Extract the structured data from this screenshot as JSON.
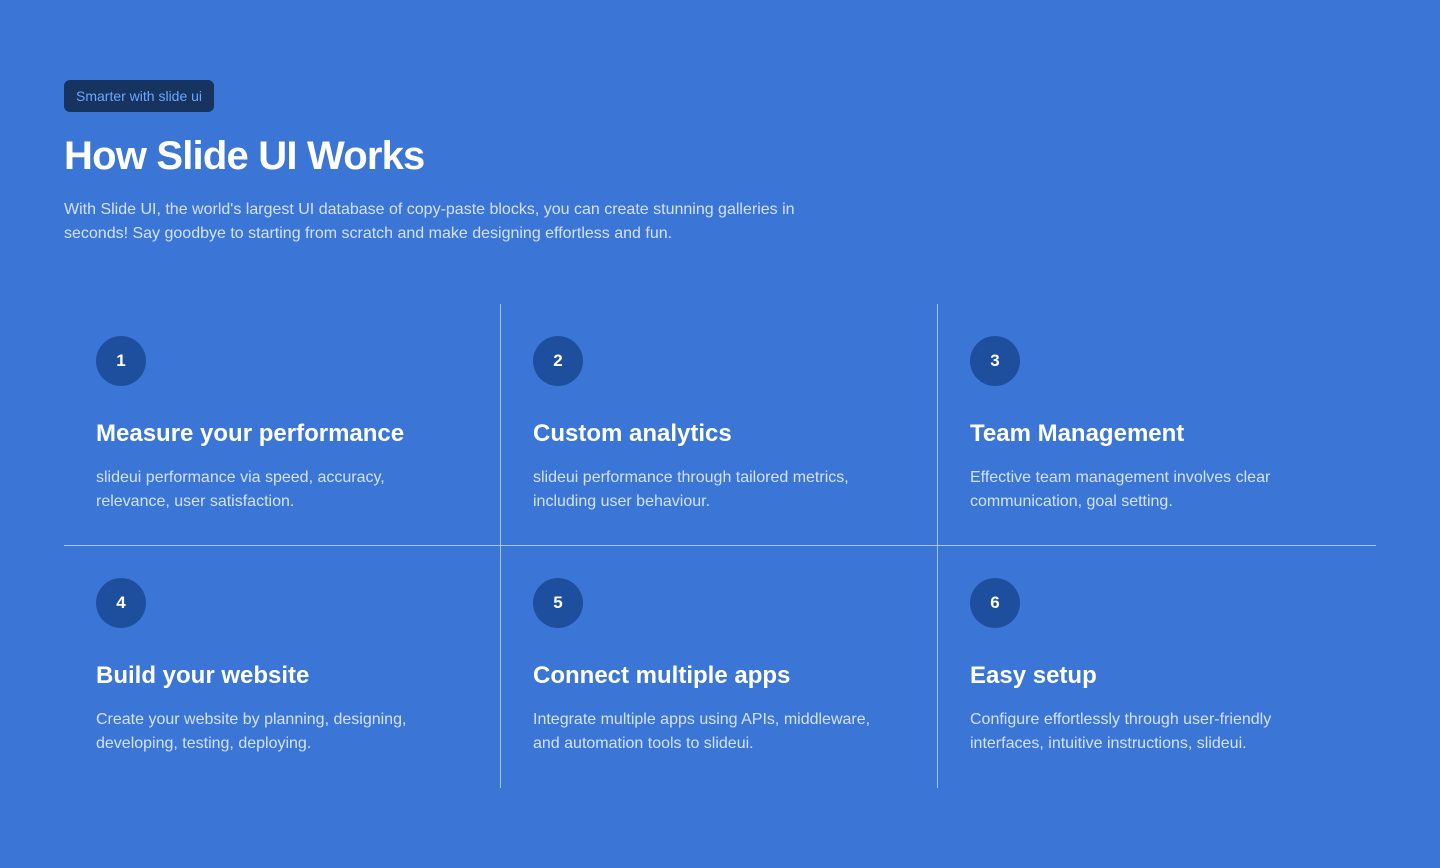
{
  "header": {
    "badge": "Smarter with slide ui",
    "title": "How Slide UI Works",
    "description": "With Slide UI, the world's largest UI database of copy-paste blocks, you can create stunning galleries in seconds! Say goodbye to starting from scratch and make designing effortless and fun."
  },
  "steps": [
    {
      "number": "1",
      "title": "Measure your performance",
      "description": "slideui performance via speed, accuracy, relevance, user satisfaction."
    },
    {
      "number": "2",
      "title": "Custom analytics",
      "description": "slideui performance through tailored metrics, including user behaviour."
    },
    {
      "number": "3",
      "title": "Team Management",
      "description": "Effective team management involves clear communication, goal setting."
    },
    {
      "number": "4",
      "title": "Build your website",
      "description": "Create your website by planning, designing, developing, testing, deploying."
    },
    {
      "number": "5",
      "title": "Connect multiple apps",
      "description": "Integrate multiple apps using APIs, middleware, and automation tools to slideui."
    },
    {
      "number": "6",
      "title": "Easy setup",
      "description": "Configure effortlessly through user-friendly interfaces, intuitive instructions, slideui."
    }
  ],
  "colors": {
    "background": "#3b76d6",
    "badge_background": "#17335f",
    "badge_text": "#6aa8ff",
    "number_circle": "#1e4f9f",
    "divider": "#a9c6f3"
  }
}
